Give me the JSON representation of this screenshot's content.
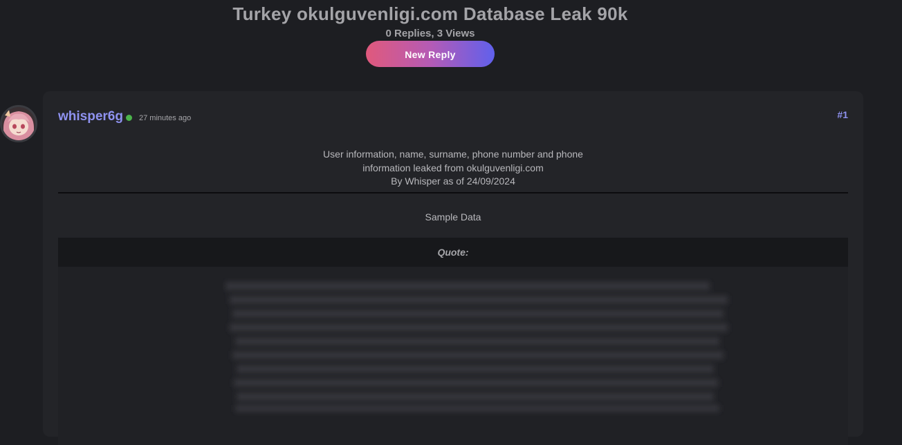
{
  "thread": {
    "title": "Turkey okulguvenligi.com Database Leak 90k",
    "stats": "0 Replies, 3 Views",
    "new_reply_label": "New Reply"
  },
  "post": {
    "author": "whisper6g",
    "online": true,
    "time": "27 minutes ago",
    "number": "#1",
    "body_lines": [
      "User information, name, surname, phone number and phone",
      "information leaked from okulguvenligi.com",
      "By Whisper as of 24/09/2024"
    ],
    "sample_label": "Sample Data",
    "quote_label": "Quote:"
  },
  "colors": {
    "accent": "#8f92f0",
    "online": "#4bb34b",
    "gradient_start": "#e0597c",
    "gradient_end": "#6060ec"
  }
}
